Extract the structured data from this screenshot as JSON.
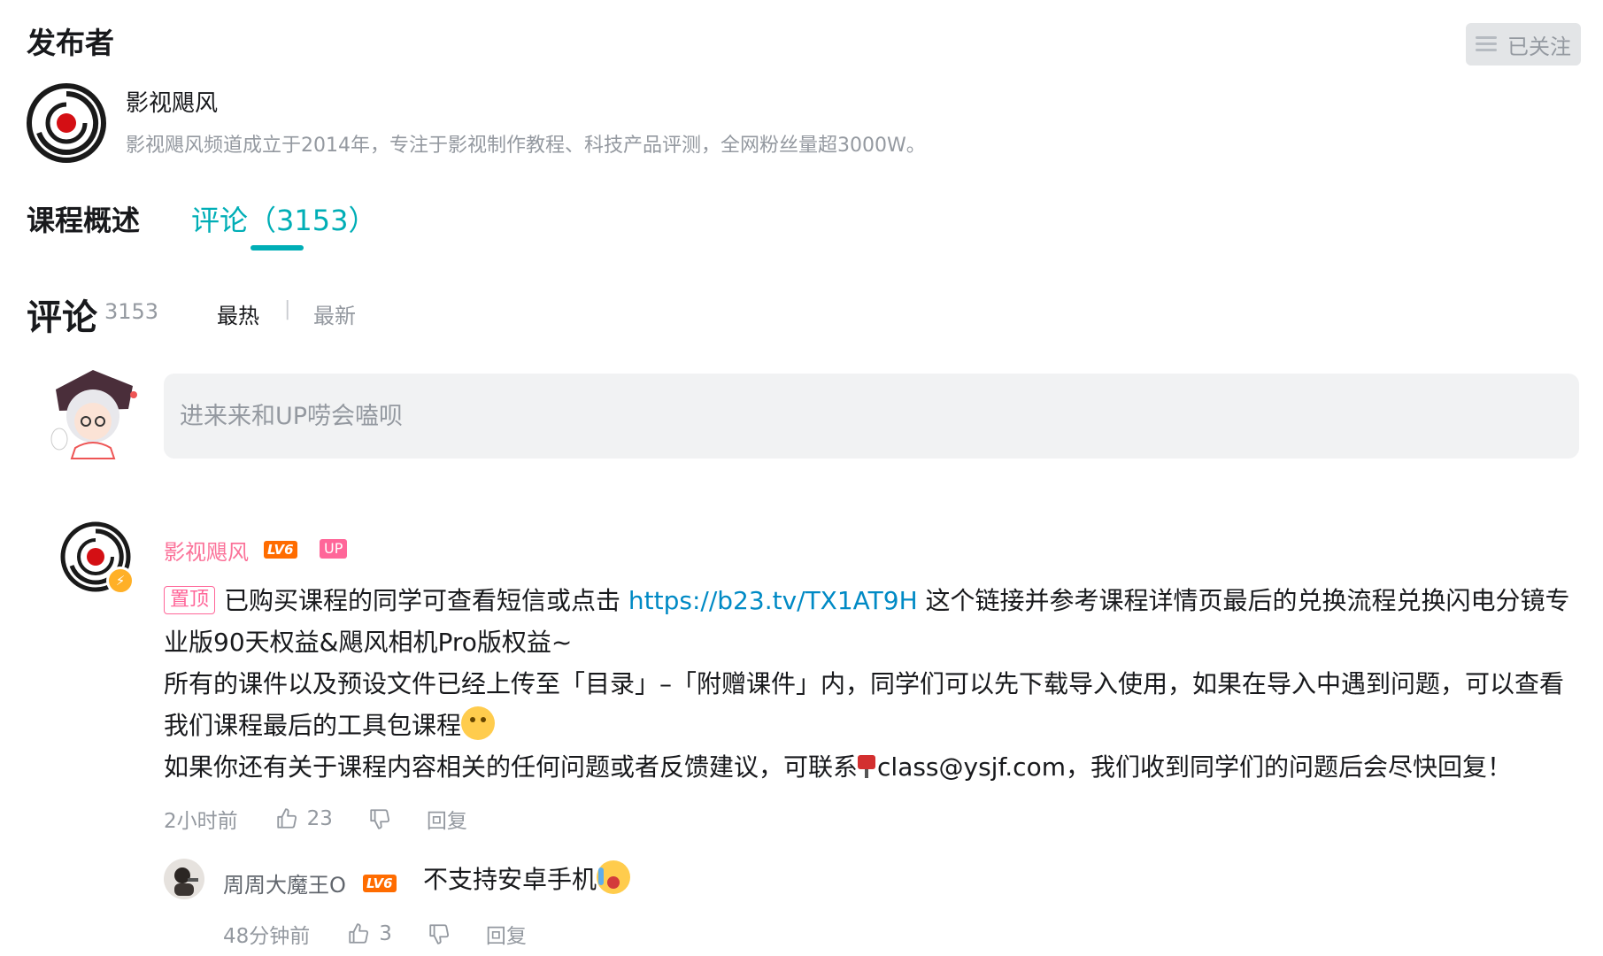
{
  "publisher": {
    "section_title": "发布者",
    "follow_label": "已关注",
    "name": "影视飓风",
    "description": "影视飓风频道成立于2014年，专注于影视制作教程、科技产品评测，全网粉丝量超3000W。"
  },
  "tabs": [
    {
      "label": "课程概述",
      "active": false
    },
    {
      "label": "评论（3153）",
      "active": true
    }
  ],
  "comments_header": {
    "title": "评论",
    "count": "3153",
    "sort_hot": "最热",
    "sort_separator": "|",
    "sort_new": "最新"
  },
  "input": {
    "placeholder": "进来来和UP唠会嗑呗"
  },
  "comment": {
    "author": "影视飓风",
    "level_badge": "LV6",
    "up_badge": "UP",
    "pinned_label": "置顶",
    "text_before_link": "已购买课程的同学可查看短信或点击 ",
    "link": "https://b23.tv/TX1AT9H",
    "text_after_link": " 这个链接并参考课程详情页最后的兑换流程兑换闪电分镜专业版90天权益&飓风相机Pro版权益~",
    "line2": "所有的课件以及预设文件已经上传至「目录」–「附赠课件」内，同学们可以先下载导入使用，如果在导入中遇到问题，可以查看我们课程最后的工具包课程",
    "line3_before_email": "如果你还有关于课程内容相关的任何问题或者反馈建议，可联系",
    "email": "class@ysjf.com",
    "line3_after_email": "，我们收到同学们的问题后会尽快回复！",
    "time": "2小时前",
    "likes": "23",
    "reply_label": "回复"
  },
  "reply": {
    "author": "周周大魔王O",
    "level_badge": "LV6",
    "text": "不支持安卓手机",
    "time": "48分钟前",
    "likes": "3",
    "reply_label": "回复"
  },
  "colors": {
    "accent": "#00aeb6",
    "up_name": "#fb7299",
    "link": "#008ac5",
    "muted": "#9499a0",
    "level": "#ff6c00"
  }
}
